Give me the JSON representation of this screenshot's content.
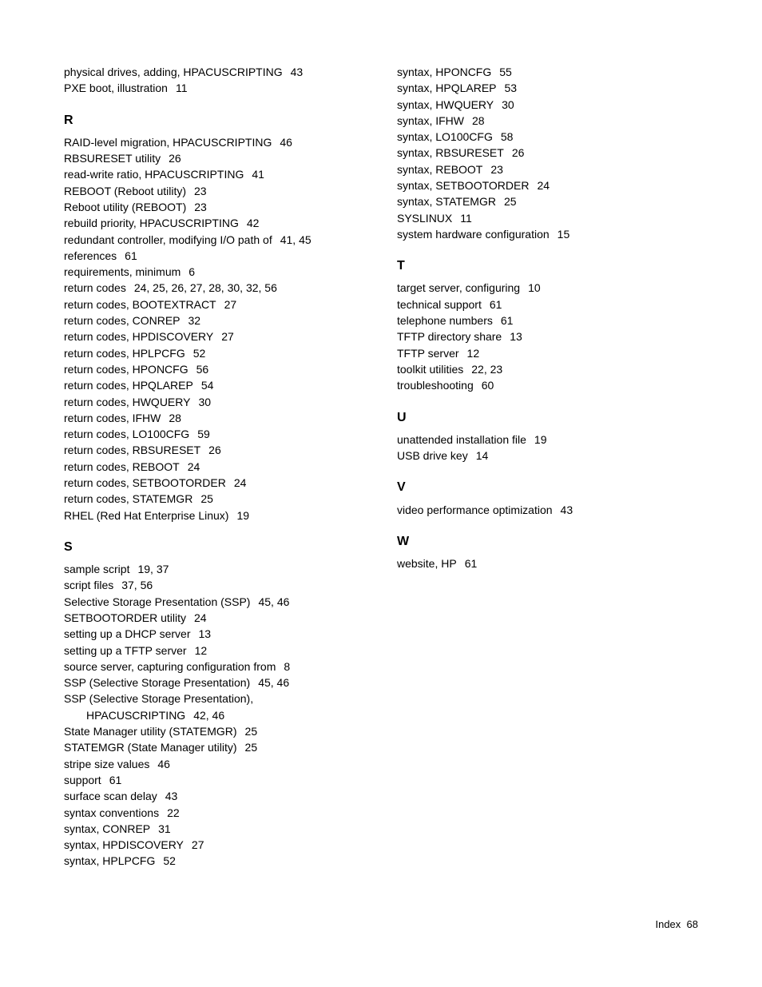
{
  "left": {
    "top": [
      {
        "text": "physical drives, adding, HPACUSCRIPTING",
        "pages": "43"
      },
      {
        "text": "PXE boot, illustration",
        "pages": "11"
      }
    ],
    "R": {
      "heading": "R",
      "items": [
        {
          "text": "RAID-level migration, HPACUSCRIPTING",
          "pages": "46"
        },
        {
          "text": "RBSURESET utility",
          "pages": "26"
        },
        {
          "text": "read-write ratio, HPACUSCRIPTING",
          "pages": "41"
        },
        {
          "text": "REBOOT (Reboot utility)",
          "pages": "23"
        },
        {
          "text": "Reboot utility (REBOOT)",
          "pages": "23"
        },
        {
          "text": "rebuild priority, HPACUSCRIPTING",
          "pages": "42"
        },
        {
          "text": "redundant controller, modifying I/O path of",
          "pages": "41, 45"
        },
        {
          "text": "references",
          "pages": "61"
        },
        {
          "text": "requirements, minimum",
          "pages": "6"
        },
        {
          "text": "return codes",
          "pages": "24, 25, 26, 27, 28, 30, 32, 56"
        },
        {
          "text": "return codes, BOOTEXTRACT",
          "pages": "27"
        },
        {
          "text": "return codes, CONREP",
          "pages": "32"
        },
        {
          "text": "return codes, HPDISCOVERY",
          "pages": "27"
        },
        {
          "text": "return codes, HPLPCFG",
          "pages": "52"
        },
        {
          "text": "return codes, HPONCFG",
          "pages": "56"
        },
        {
          "text": "return codes, HPQLAREP",
          "pages": "54"
        },
        {
          "text": "return codes, HWQUERY",
          "pages": "30"
        },
        {
          "text": "return codes, IFHW",
          "pages": "28"
        },
        {
          "text": "return codes, LO100CFG",
          "pages": "59"
        },
        {
          "text": "return codes, RBSURESET",
          "pages": "26"
        },
        {
          "text": "return codes, REBOOT",
          "pages": "24"
        },
        {
          "text": "return codes, SETBOOTORDER",
          "pages": "24"
        },
        {
          "text": "return codes, STATEMGR",
          "pages": "25"
        },
        {
          "text": "RHEL (Red Hat Enterprise Linux)",
          "pages": "19"
        }
      ]
    },
    "S": {
      "heading": "S",
      "items": [
        {
          "text": "sample script",
          "pages": "19, 37"
        },
        {
          "text": "script files",
          "pages": "37, 56"
        },
        {
          "text": "Selective Storage Presentation (SSP)",
          "pages": "45, 46"
        },
        {
          "text": "SETBOOTORDER utility",
          "pages": "24"
        },
        {
          "text": "setting up a DHCP server",
          "pages": "13"
        },
        {
          "text": "setting up a TFTP server",
          "pages": "12"
        },
        {
          "text": "source server, capturing configuration from",
          "pages": "8"
        },
        {
          "text": "SSP (Selective Storage Presentation)",
          "pages": "45, 46"
        },
        {
          "text": "SSP (Selective Storage Presentation),",
          "pages": ""
        },
        {
          "text": "HPACUSCRIPTING",
          "pages": "42, 46",
          "indent": true
        },
        {
          "text": "State Manager utility (STATEMGR)",
          "pages": "25"
        },
        {
          "text": "STATEMGR (State Manager utility)",
          "pages": "25"
        },
        {
          "text": "stripe size values",
          "pages": "46"
        },
        {
          "text": "support",
          "pages": "61"
        },
        {
          "text": "surface scan delay",
          "pages": "43"
        },
        {
          "text": "syntax conventions",
          "pages": "22"
        },
        {
          "text": "syntax, CONREP",
          "pages": "31"
        },
        {
          "text": "syntax, HPDISCOVERY",
          "pages": "27"
        },
        {
          "text": "syntax, HPLPCFG",
          "pages": "52"
        }
      ]
    }
  },
  "right": {
    "top": [
      {
        "text": "syntax, HPONCFG",
        "pages": "55"
      },
      {
        "text": "syntax, HPQLAREP",
        "pages": "53"
      },
      {
        "text": "syntax, HWQUERY",
        "pages": "30"
      },
      {
        "text": "syntax, IFHW",
        "pages": "28"
      },
      {
        "text": "syntax, LO100CFG",
        "pages": "58"
      },
      {
        "text": "syntax, RBSURESET",
        "pages": "26"
      },
      {
        "text": "syntax, REBOOT",
        "pages": "23"
      },
      {
        "text": "syntax, SETBOOTORDER",
        "pages": "24"
      },
      {
        "text": "syntax, STATEMGR",
        "pages": "25"
      },
      {
        "text": "SYSLINUX",
        "pages": "11"
      },
      {
        "text": "system hardware configuration",
        "pages": "15"
      }
    ],
    "T": {
      "heading": "T",
      "items": [
        {
          "text": "target server, configuring",
          "pages": "10"
        },
        {
          "text": "technical support",
          "pages": "61"
        },
        {
          "text": "telephone numbers",
          "pages": "61"
        },
        {
          "text": "TFTP directory share",
          "pages": "13"
        },
        {
          "text": "TFTP server",
          "pages": "12"
        },
        {
          "text": "toolkit utilities",
          "pages": "22, 23"
        },
        {
          "text": "troubleshooting",
          "pages": "60"
        }
      ]
    },
    "U": {
      "heading": "U",
      "items": [
        {
          "text": "unattended installation file",
          "pages": "19"
        },
        {
          "text": "USB drive key",
          "pages": "14"
        }
      ]
    },
    "V": {
      "heading": "V",
      "items": [
        {
          "text": "video performance optimization",
          "pages": "43"
        }
      ]
    },
    "W": {
      "heading": "W",
      "items": [
        {
          "text": "website, HP",
          "pages": "61"
        }
      ]
    }
  },
  "footer": {
    "label": "Index",
    "page": "68"
  }
}
